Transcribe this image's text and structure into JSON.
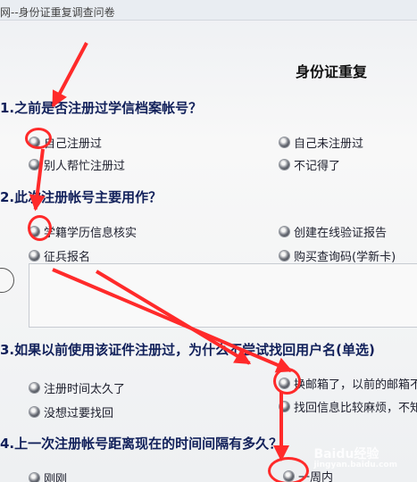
{
  "window": {
    "title": "网--身份证重复调查问卷"
  },
  "survey": {
    "title": "身份证重复",
    "questions": [
      {
        "label": "1.之前是否注册过学信档案帐号？",
        "options": [
          "自己注册过",
          "自己未注册过",
          "别人帮忙注册过",
          "不记得了"
        ]
      },
      {
        "label": "2.此次注册帐号主要用作？",
        "options": [
          "学籍学历信息核实",
          "创建在线验证报告",
          "征兵报名",
          "购买查询码(学新卡)"
        ]
      },
      {
        "label": "3.如果以前使用该证件注册过，为什么不尝试找回用户名(单选)",
        "options": [
          "注册时间太久了",
          "换邮箱了，以前的邮箱不",
          "没想过要找回",
          "找回信息比较麻烦，不知"
        ]
      },
      {
        "label": "4.上一次注册帐号距离现在的时间间隔有多久？",
        "options": [
          "刚刚",
          "一周内"
        ]
      }
    ]
  },
  "watermark": {
    "brand": "Baidu经验",
    "domain": "jingyan.baidu.com"
  },
  "colors": {
    "annotation": "#ff2a2a",
    "question_text": "#11205a"
  }
}
